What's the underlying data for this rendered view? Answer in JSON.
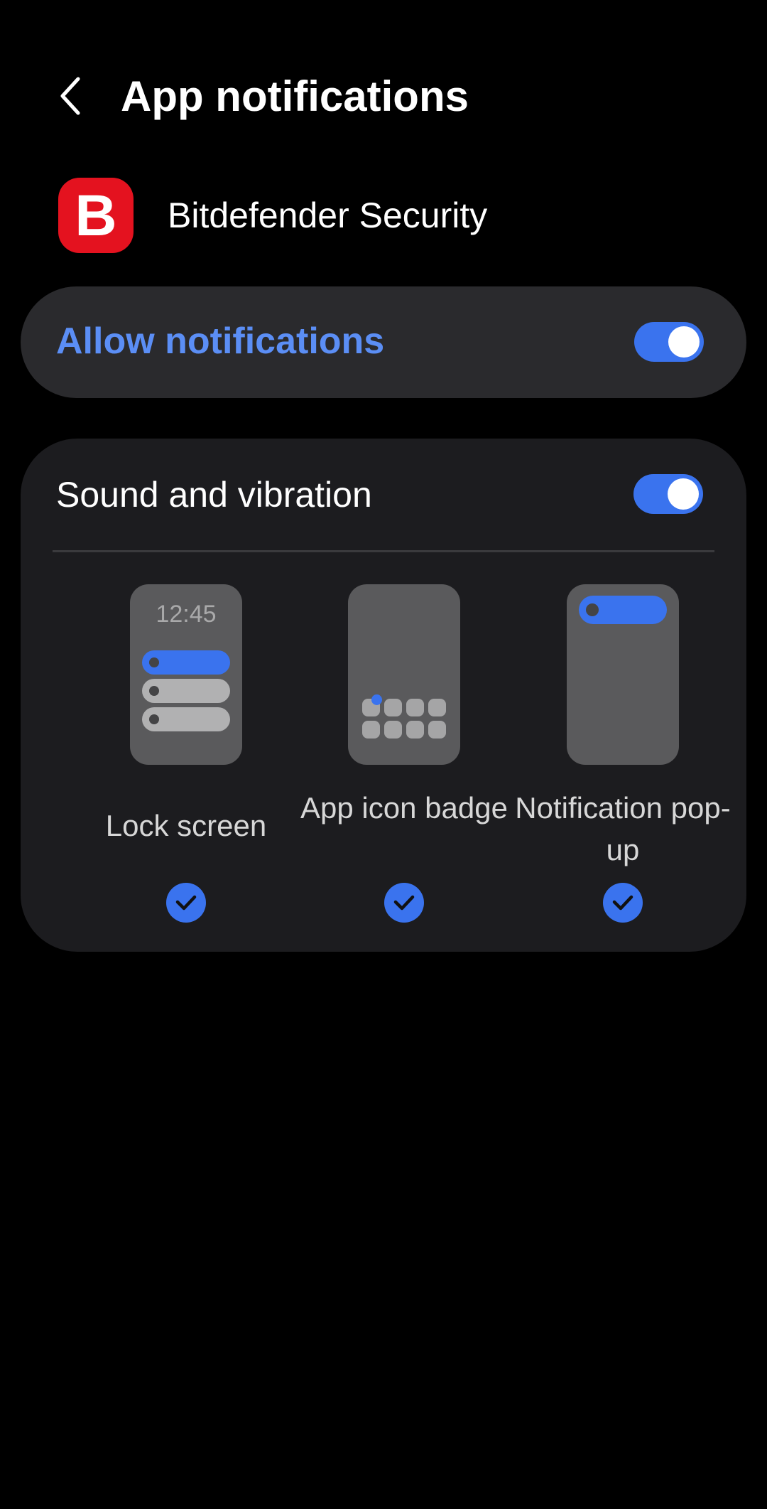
{
  "header": {
    "title": "App notifications",
    "back_icon": "chevron-left-icon"
  },
  "app": {
    "name": "Bitdefender Security",
    "icon_letter": "B",
    "icon_color": "#e4121f"
  },
  "allow_notifications": {
    "label": "Allow notifications",
    "enabled": true,
    "label_color": "#5b8ef5"
  },
  "sound_and_vibration": {
    "label": "Sound and vibration",
    "enabled": true
  },
  "notification_styles": {
    "options": [
      {
        "label": "Lock screen",
        "selected": true,
        "preview_time": "12:45"
      },
      {
        "label": "App icon badge",
        "selected": true
      },
      {
        "label": "Notification pop-up",
        "selected": true
      }
    ]
  },
  "colors": {
    "accent": "#3a73ee",
    "background": "#000000",
    "card": "#1c1c1f",
    "allow_card": "#2a2a2d"
  }
}
